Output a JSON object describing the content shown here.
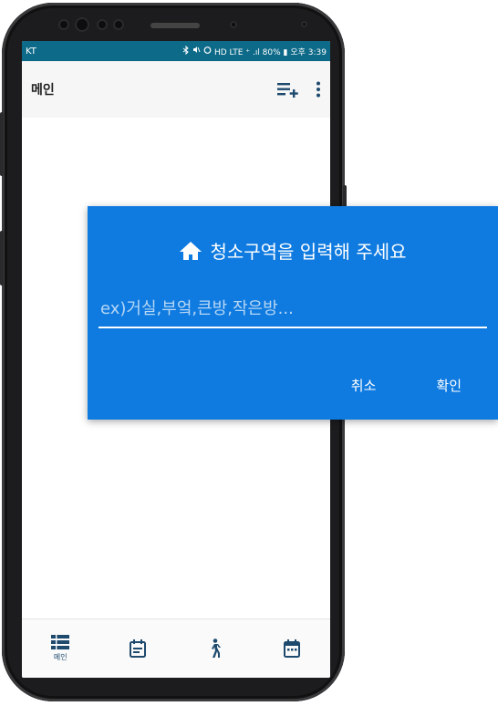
{
  "status_bar": {
    "carrier": "KT",
    "right_text": "HD LTE ⁺ .ıl 80% ▮ 오후 3:39"
  },
  "app_bar": {
    "title": "메인",
    "add_list_icon": "playlist-add-icon",
    "more_icon": "more-vert-icon"
  },
  "bottom_nav": {
    "items": [
      {
        "label": "메인",
        "icon": "list-icon"
      },
      {
        "label": "",
        "icon": "event-note-icon"
      },
      {
        "label": "",
        "icon": "walk-icon"
      },
      {
        "label": "",
        "icon": "calendar-icon"
      }
    ]
  },
  "dialog": {
    "title": "청소구역을 입력해 주세요",
    "title_icon": "home-icon",
    "input_placeholder": "ex)거실,부엌,큰방,작은방...",
    "input_value": "",
    "cancel_label": "취소",
    "confirm_label": "확인"
  },
  "colors": {
    "dialog_bg": "#0f7be0",
    "status_bar": "#0d6a88",
    "accent_nav": "#1e4a6e",
    "phone_body": "#1c1c1e"
  }
}
